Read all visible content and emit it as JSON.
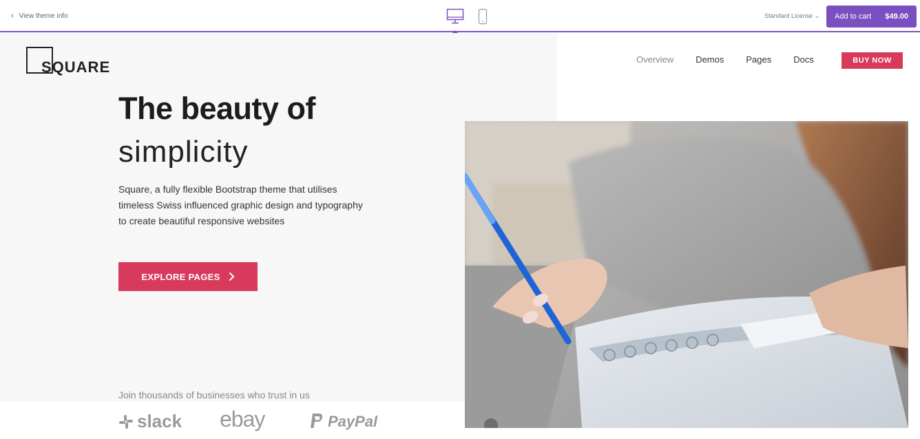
{
  "topbar": {
    "back_label": "View theme info",
    "license_label": "Standard License",
    "cart": {
      "label": "Add to cart",
      "price": "$49.00"
    },
    "devices": [
      "desktop",
      "mobile"
    ],
    "accent": "#7b4fbf"
  },
  "site": {
    "logo_text": "SQUARE",
    "nav": [
      {
        "label": "Overview"
      },
      {
        "label": "Demos"
      },
      {
        "label": "Pages"
      },
      {
        "label": "Docs"
      }
    ],
    "buy_label": "BUY NOW",
    "headline": "The beauty of",
    "subhead": "simplicity",
    "lead": "Square, a fully flexible Bootstrap theme that utilises timeless Swiss influenced graphic design and typography to create beautiful responsive websites",
    "cta_label": "EXPLORE PAGES",
    "trust_text": "Join thousands of businesses who trust in us",
    "brands": [
      "slack",
      "ebay",
      "PayPal"
    ],
    "accent": "#d83a5c",
    "hero_image": "hand-writing-in-notebook-photo"
  }
}
